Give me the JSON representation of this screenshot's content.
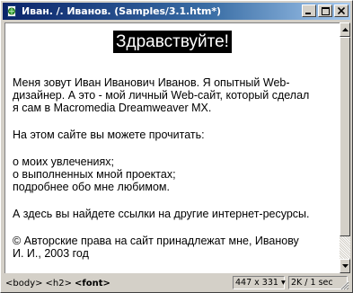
{
  "window": {
    "title": "Иван. /. Иванов. (Samples/3.1.htm*)"
  },
  "page": {
    "heading": "Здравствуйте!",
    "intro_line1": "Меня зовут Иван Иванович Иванов. Я опытный Web-",
    "intro_line2": "дизайнер. А это - мой личный Web-сайт, который сделал",
    "intro_line3": "я сам в Macromedia Dreamweaver MX.",
    "read_line": "На этом сайте вы можете прочитать:",
    "list_line1": "о моих увлечениях;",
    "list_line2": "о выполненных мной проектах;",
    "list_line3": "подробнее обо мне любимом.",
    "links_line": "А здесь вы найдете ссылки на другие интернет-ресурсы.",
    "copy_line1": "© Авторские права на сайт принадлежат мне, Иванову",
    "copy_line2": "И. И., 2003 год"
  },
  "statusbar": {
    "tags": [
      "<body>",
      "<h2>",
      "<font>"
    ],
    "size": "447 x 331 ▾",
    "speed": "2K / 1 sec"
  },
  "colors": {
    "title_bar": "#0a246a",
    "chrome": "#d4d0c8",
    "content_bg": "#ffffff",
    "heading_bg": "#000000",
    "heading_text": "#ffffff"
  },
  "icons": {
    "app": "dreamweaver-document-icon",
    "minimize": "minimize-icon",
    "maximize": "maximize-icon",
    "close": "close-icon",
    "scroll_up": "arrow-up-icon",
    "scroll_down": "arrow-down-icon",
    "grip": "resize-grip-icon"
  }
}
